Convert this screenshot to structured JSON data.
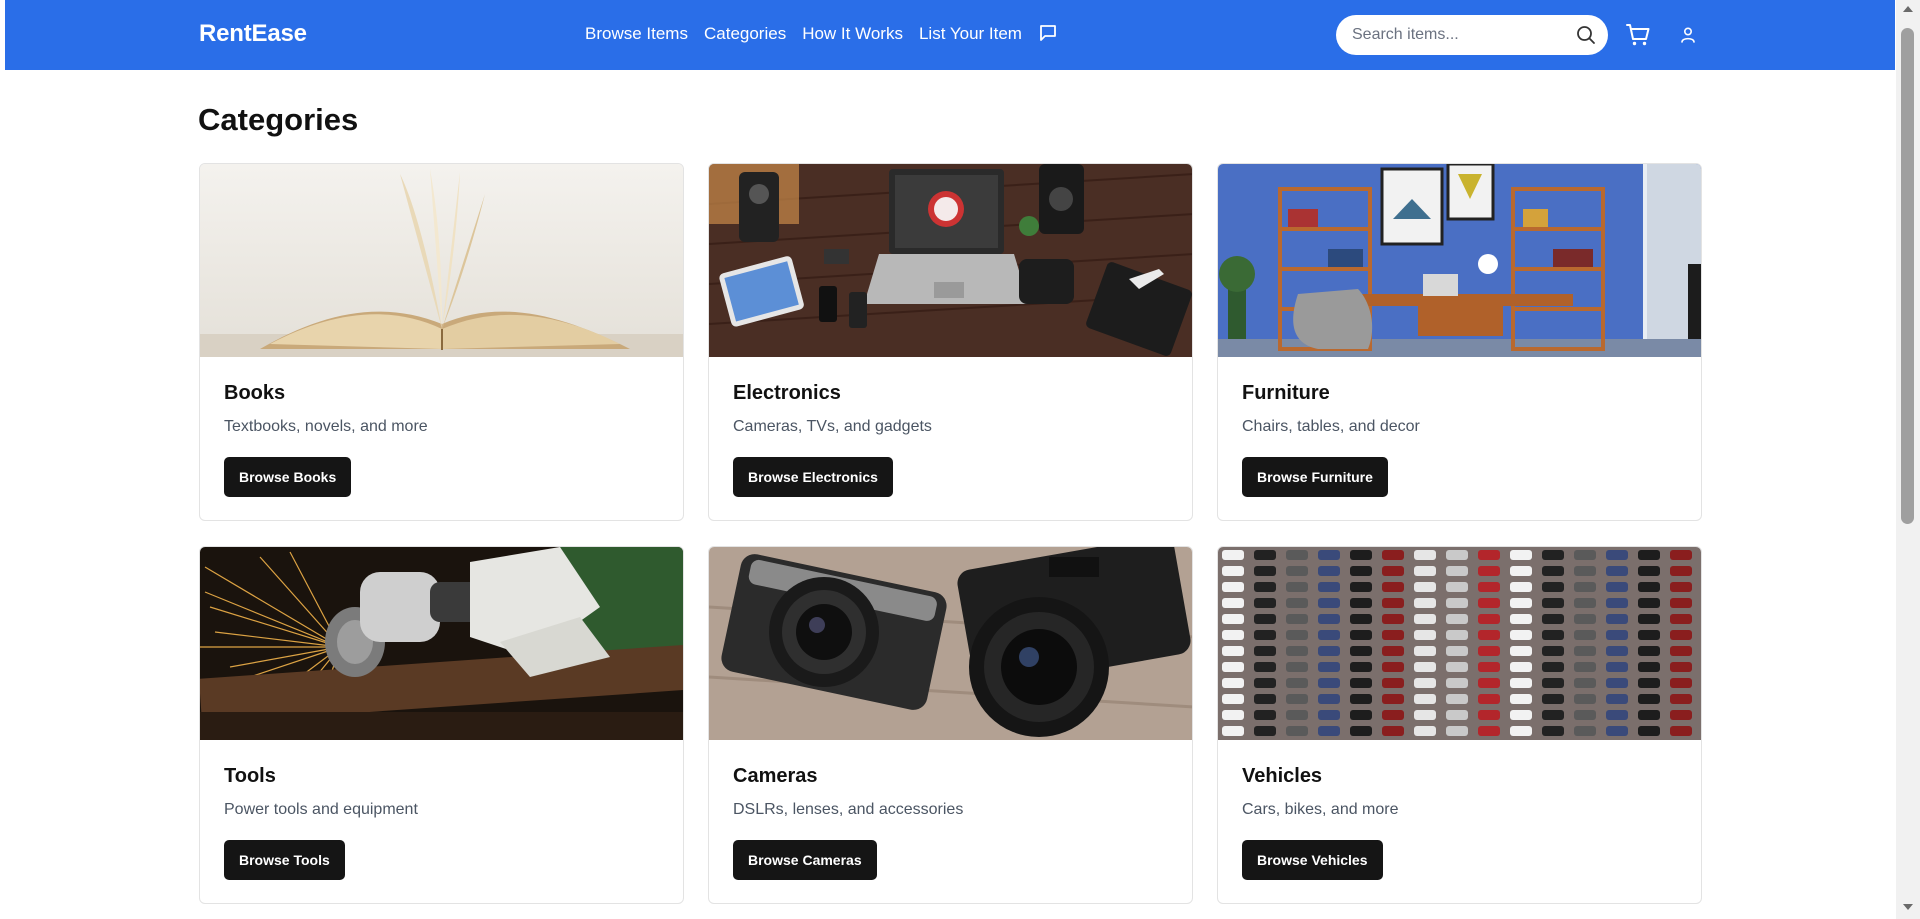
{
  "header": {
    "brand": "RentEase",
    "nav_items": [
      {
        "label": "Browse Items"
      },
      {
        "label": "Categories"
      },
      {
        "label": "How It Works"
      },
      {
        "label": "List Your Item"
      }
    ],
    "chat_icon": "message-square-icon",
    "search": {
      "placeholder": "Search items...",
      "value": "",
      "icon": "search-icon"
    },
    "cart_icon": "shopping-cart-icon",
    "user_icon": "user-icon",
    "colors": {
      "nav_bg": "#2a6ee8",
      "nav_text": "#ffffff"
    }
  },
  "main": {
    "title": "Categories",
    "categories": [
      {
        "title": "Books",
        "description": "Textbooks, novels, and more",
        "button": "Browse Books",
        "image": "open-book-photo"
      },
      {
        "title": "Electronics",
        "description": "Cameras, TVs, and gadgets",
        "button": "Browse Electronics",
        "image": "desk-electronics-photo"
      },
      {
        "title": "Furniture",
        "description": "Chairs, tables, and decor",
        "button": "Browse Furniture",
        "image": "home-office-photo"
      },
      {
        "title": "Tools",
        "description": "Power tools and equipment",
        "button": "Browse Tools",
        "image": "angle-grinder-sparks-photo"
      },
      {
        "title": "Cameras",
        "description": "DSLRs, lenses, and accessories",
        "button": "Browse Cameras",
        "image": "mirrorless-cameras-photo"
      },
      {
        "title": "Vehicles",
        "description": "Cars, bikes, and more",
        "button": "Browse Vehicles",
        "image": "parking-lot-aerial-photo"
      }
    ],
    "colors": {
      "button_bg": "#151515",
      "button_text": "#ffffff",
      "description": "#4b5563"
    }
  }
}
